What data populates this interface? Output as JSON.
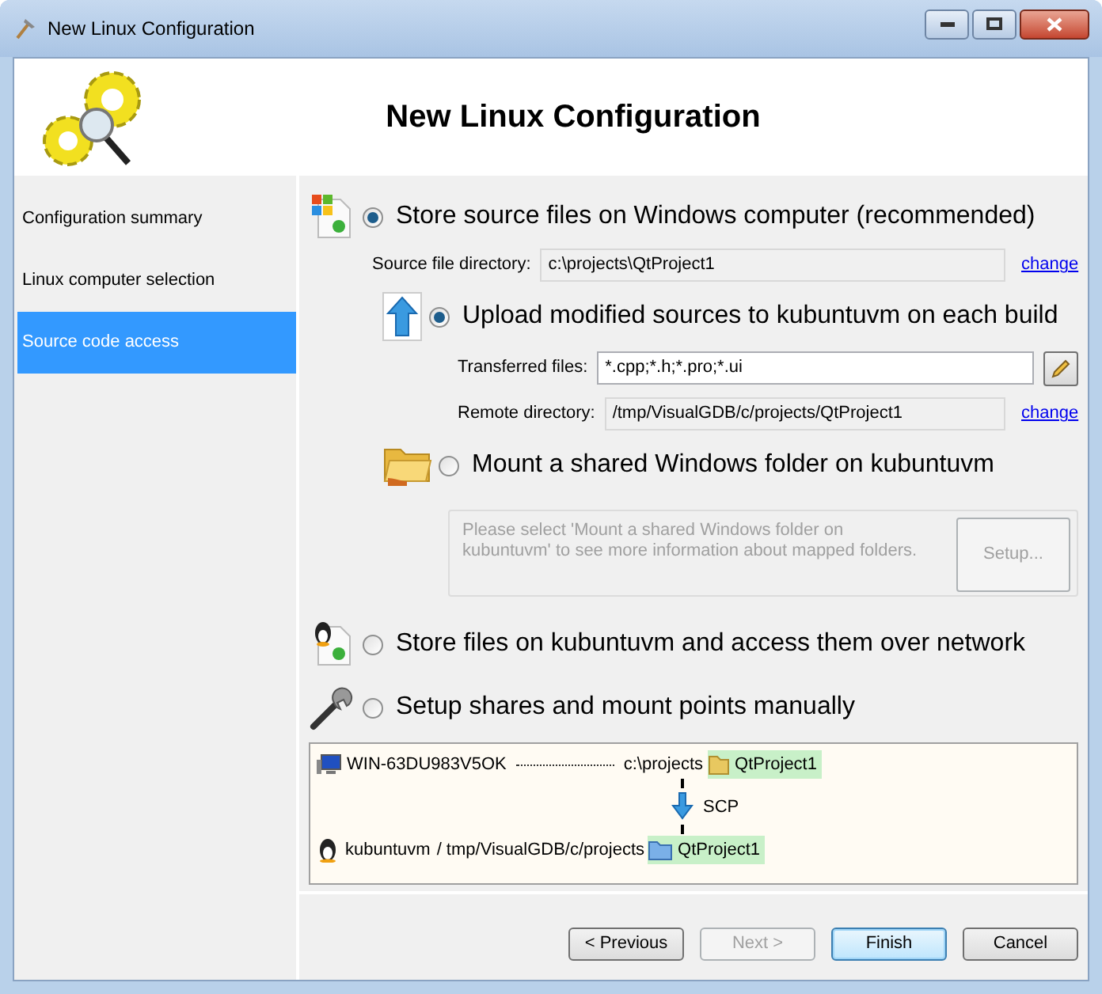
{
  "window": {
    "title": "New Linux Configuration"
  },
  "header": {
    "title": "New Linux Configuration"
  },
  "sidebar": {
    "items": [
      {
        "label": "Configuration summary",
        "selected": false
      },
      {
        "label": "Linux computer selection",
        "selected": false
      },
      {
        "label": "Source code access",
        "selected": true
      }
    ]
  },
  "options": [
    {
      "kind": "windows",
      "label": "Store source files on Windows computer (recommended)",
      "selected": true,
      "fields": [
        {
          "label": "Source file directory:",
          "value": "c:\\projects\\QtProject1",
          "link": "change"
        }
      ],
      "suboptions": [
        {
          "kind": "upload",
          "label": "Upload modified sources to kubuntuvm on each build",
          "selected": true,
          "fields": [
            {
              "label": "Transferred files:",
              "value": "*.cpp;*.h;*.pro;*.ui",
              "editable": true
            },
            {
              "label": "Remote directory:",
              "value": "/tmp/VisualGDB/c/projects/QtProject1",
              "link": "change"
            }
          ]
        },
        {
          "kind": "mount",
          "label": "Mount a shared Windows folder on kubuntuvm",
          "selected": false,
          "info": {
            "text": "Please select 'Mount a shared Windows folder on kubuntuvm' to see more information about mapped folders.",
            "button": "Setup...",
            "disabled": true
          }
        }
      ]
    },
    {
      "kind": "linux",
      "label": "Store files on kubuntuvm and access them over network",
      "selected": false
    },
    {
      "kind": "manual",
      "label": "Setup shares and mount points manually",
      "selected": false
    }
  ],
  "diagram": {
    "source": {
      "host": "WIN-63DU983V5OK",
      "path": "c:\\projects",
      "project": "QtProject1"
    },
    "transfer": "SCP",
    "target": {
      "host": "kubuntuvm",
      "path": "/ tmp/VisualGDB/c/projects",
      "project": "QtProject1"
    }
  },
  "buttons": [
    {
      "label": "< Previous",
      "disabled": false,
      "default": false
    },
    {
      "label": "Next >",
      "disabled": true,
      "default": false
    },
    {
      "label": "Finish",
      "disabled": false,
      "default": true
    },
    {
      "label": "Cancel",
      "disabled": false,
      "default": false
    }
  ]
}
